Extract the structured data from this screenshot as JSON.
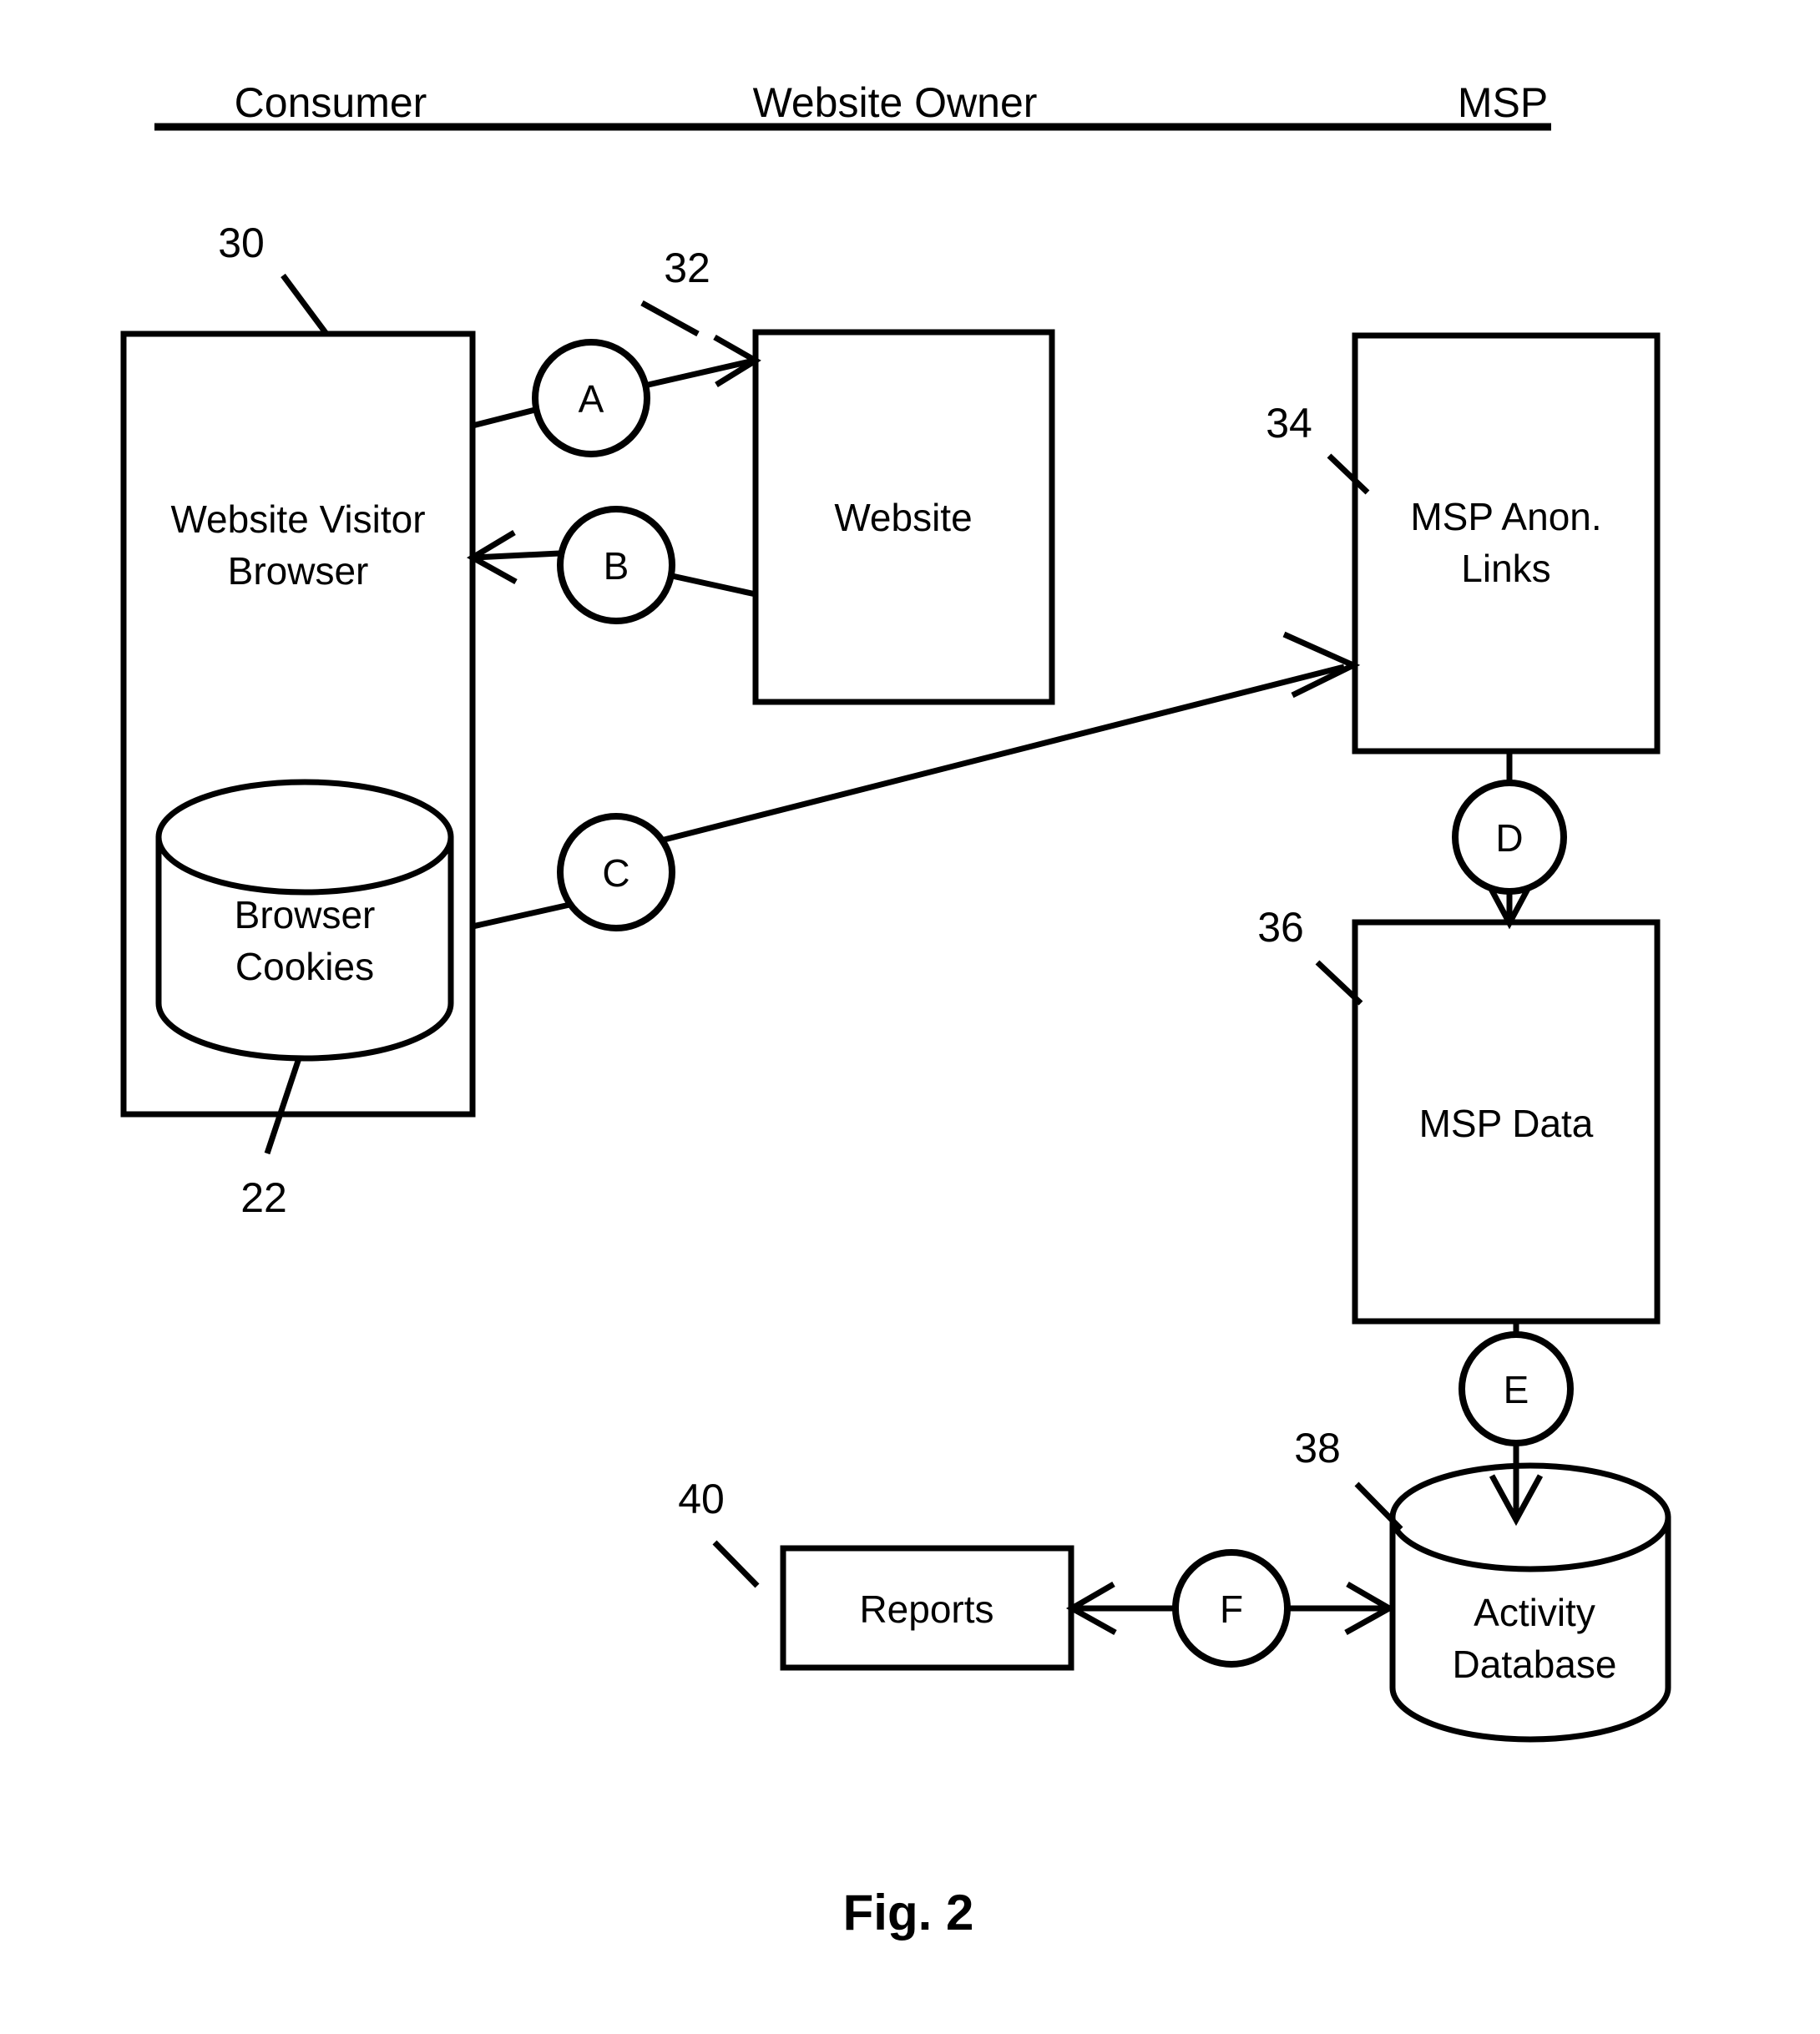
{
  "figure": {
    "caption": "Fig. 2",
    "columns": [
      {
        "label": "Consumer"
      },
      {
        "label": "Website Owner"
      },
      {
        "label": "MSP"
      }
    ],
    "nodes": [
      {
        "id": "website-visitor-browser",
        "label_line1": "Website Visitor",
        "label_line2": "Browser",
        "ref": "30",
        "shape": "rectangle"
      },
      {
        "id": "browser-cookies",
        "label_line1": "Browser",
        "label_line2": "Cookies",
        "ref": "22",
        "shape": "cylinder"
      },
      {
        "id": "website",
        "label_line1": "Website",
        "label_line2": "",
        "ref": "32",
        "shape": "rectangle"
      },
      {
        "id": "msp-anon-links",
        "label_line1": "MSP Anon.",
        "label_line2": "Links",
        "ref": "34",
        "shape": "rectangle"
      },
      {
        "id": "msp-data",
        "label_line1": "MSP Data",
        "label_line2": "",
        "ref": "36",
        "shape": "rectangle"
      },
      {
        "id": "activity-database",
        "label_line1": "Activity",
        "label_line2": "Database",
        "ref": "38",
        "shape": "cylinder"
      },
      {
        "id": "reports",
        "label_line1": "Reports",
        "label_line2": "",
        "ref": "40",
        "shape": "rectangle"
      }
    ],
    "connectors": [
      {
        "id": "A",
        "label": "A",
        "from": "website-visitor-browser",
        "to": "website"
      },
      {
        "id": "B",
        "label": "B",
        "from": "website",
        "to": "website-visitor-browser"
      },
      {
        "id": "C",
        "label": "C",
        "from": "browser-cookies",
        "to": "msp-anon-links"
      },
      {
        "id": "D",
        "label": "D",
        "from": "msp-anon-links",
        "to": "msp-data"
      },
      {
        "id": "E",
        "label": "E",
        "from": "msp-data",
        "to": "activity-database"
      },
      {
        "id": "F",
        "label": "F",
        "from": "activity-database",
        "to": "reports"
      }
    ],
    "colors": {
      "ink": "#000000",
      "paper": "#ffffff"
    }
  }
}
